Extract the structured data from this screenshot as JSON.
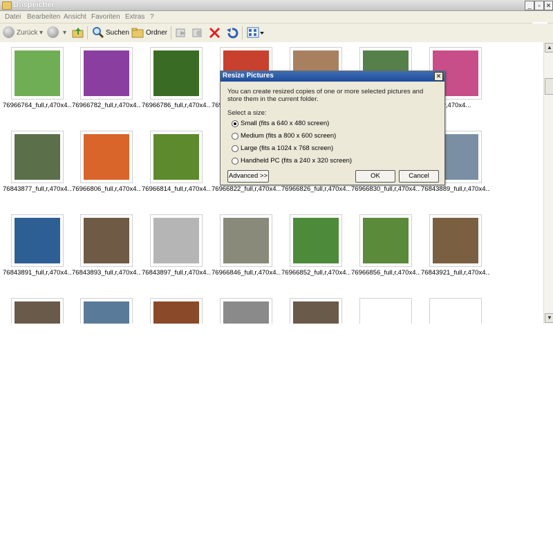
{
  "window": {
    "title": "D:\\speicher"
  },
  "menu": [
    "Datei",
    "Bearbeiten",
    "Ansicht",
    "Favoriten",
    "Extras",
    "?"
  ],
  "toolbar": {
    "back": "Zurück",
    "search": "Suchen",
    "folders": "Ordner"
  },
  "files": [
    {
      "name": "76966764_full,r,470x4...",
      "icon": "ladybug-photo",
      "color": "#6fae55"
    },
    {
      "name": "76966782_full,r,470x4...",
      "icon": "purple-flowers-photo",
      "color": "#8a3fa0"
    },
    {
      "name": "76966786_full,r,470x4...",
      "icon": "daisy-photo",
      "color": "#3a6b25"
    },
    {
      "name": "76966...",
      "icon": "red-flowers-photo",
      "color": "#c8402e"
    },
    {
      "name": "",
      "icon": "pink-flower-photo",
      "color": "#a88060"
    },
    {
      "name": "",
      "icon": "pink-flowers-photo",
      "color": "#55804a"
    },
    {
      "name": "...5_full,r,470x4...",
      "icon": "pink-lily-photo",
      "color": "#c74e88"
    },
    {
      "name": "76843877_full,r,470x4...",
      "icon": "white-flowers-photo",
      "color": "#5b6f4a"
    },
    {
      "name": "76966806_full,r,470x4...",
      "icon": "orange-flowers-photo",
      "color": "#d9652a"
    },
    {
      "name": "76966814_full,r,470x4...",
      "icon": "yellow-flower-photo",
      "color": "#5d8a2c"
    },
    {
      "name": "76966822_full,r,470x4...",
      "icon": "photo",
      "color": "#d9d9d9"
    },
    {
      "name": "76966826_full,r,470x4...",
      "icon": "photo",
      "color": "#d9d9d9"
    },
    {
      "name": "76966830_full,r,470x4...",
      "icon": "photo",
      "color": "#d9d9d9"
    },
    {
      "name": "76843889_full,r,470x4...",
      "icon": "winter-shore-photo",
      "color": "#7a8fa3"
    },
    {
      "name": "76843891_full,r,470x4...",
      "icon": "fountain-photo",
      "color": "#2d5f94"
    },
    {
      "name": "76843893_full,r,470x4...",
      "icon": "sunset-lake-photo",
      "color": "#6e5a45"
    },
    {
      "name": "76843897_full,r,470x4...",
      "icon": "tunnel-photo",
      "color": "#b5b5b5"
    },
    {
      "name": "76966846_full,r,470x4...",
      "icon": "cat-path-photo",
      "color": "#8a8a7a"
    },
    {
      "name": "76966852_full,r,470x4...",
      "icon": "cat-grass-photo",
      "color": "#4d8a3a"
    },
    {
      "name": "76966856_full,r,470x4...",
      "icon": "cat-lying-photo",
      "color": "#5a8a3a"
    },
    {
      "name": "76843921_full,r,470x4...",
      "icon": "cat-closeup-photo",
      "color": "#7a6040"
    },
    {
      "name": "",
      "icon": "cat-photo",
      "color": "#6a5a4a"
    },
    {
      "name": "",
      "icon": "cat-photo",
      "color": "#5a7a9a"
    },
    {
      "name": "",
      "icon": "cat-photo",
      "color": "#8a4a2a"
    },
    {
      "name": "",
      "icon": "cat-photo",
      "color": "#8a8a8a"
    },
    {
      "name": "",
      "icon": "cat-photo",
      "color": "#6a5a4a"
    },
    {
      "name": "",
      "icon": "generic-file-icon",
      "color": "#ffffff"
    },
    {
      "name": "",
      "icon": "dark-dots-file-icon",
      "color": "#ffffff"
    }
  ],
  "dialog": {
    "title": "Resize Pictures",
    "description": "You can create resized copies of one or more selected pictures and store them in the current folder.",
    "select_label": "Select a size:",
    "options": [
      {
        "label": "Small (fits a 640 x 480 screen)",
        "selected": true
      },
      {
        "label": "Medium (fits a 800 x 600 screen)",
        "selected": false
      },
      {
        "label": "Large (fits a 1024 x 768 screen)",
        "selected": false
      },
      {
        "label": "Handheld PC (fits a 240 x 320 screen)",
        "selected": false
      }
    ],
    "advanced": "Advanced >>",
    "ok": "OK",
    "cancel": "Cancel"
  }
}
